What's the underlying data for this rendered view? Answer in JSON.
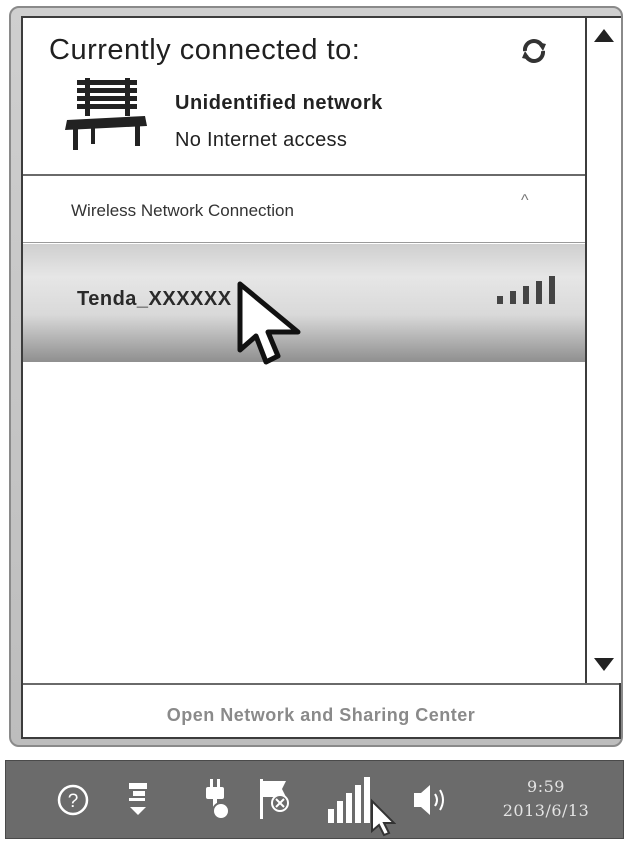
{
  "popup": {
    "header": {
      "title": "Currently connected to:",
      "network_name": "Unidentified network",
      "network_status": "No Internet access",
      "refresh_icon": "refresh-icon",
      "network_icon": "bench-network-icon"
    },
    "section": {
      "label": "Wireless Network Connection",
      "caret": "^"
    },
    "networks": [
      {
        "ssid": "Tenda_XXXXXX",
        "signal_bars": 5,
        "selected": true
      }
    ],
    "footer": {
      "link": "Open Network and Sharing Center"
    }
  },
  "taskbar": {
    "icons": [
      "help-icon",
      "display-icon",
      "power-plug-icon",
      "action-center-flag-icon",
      "wifi-signal-icon",
      "speaker-icon"
    ],
    "clock_time": "9:59",
    "clock_date": "2013/6/13"
  },
  "colors": {
    "selection_gradient_top": "#e6e6e6",
    "selection_gradient_bottom": "#8f8f8f",
    "taskbar": "#6b6b6b"
  }
}
